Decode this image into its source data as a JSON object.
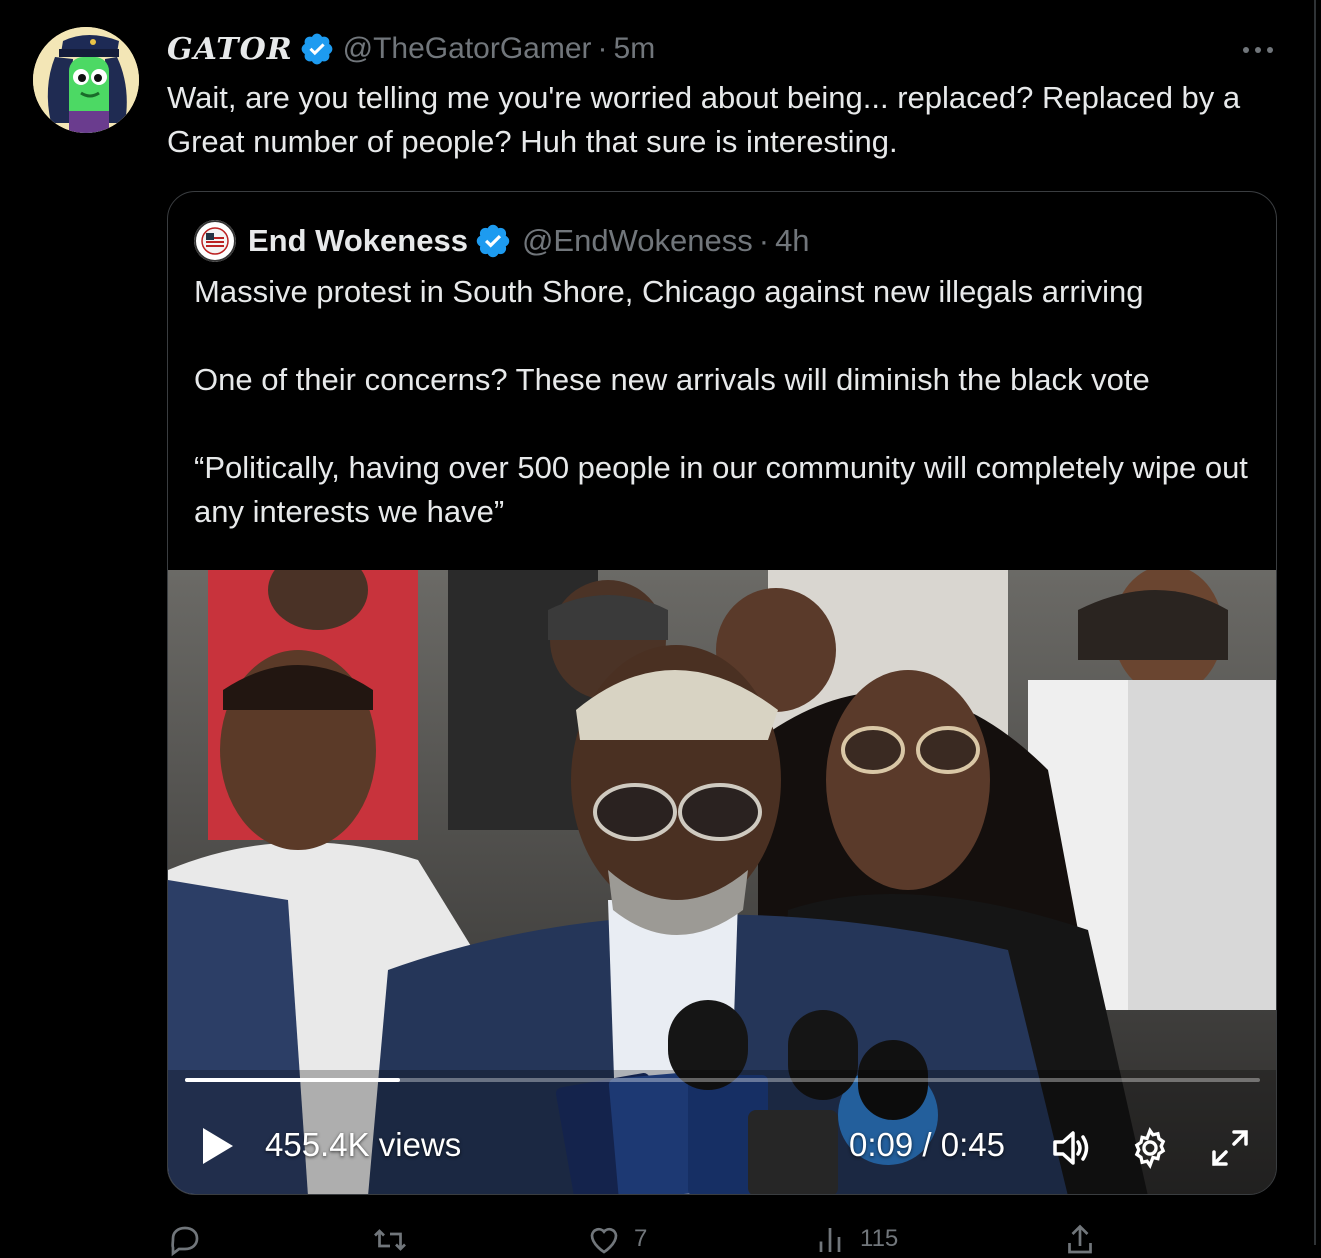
{
  "tweet": {
    "display_name": "GATOR",
    "handle": "@TheGatorGamer",
    "separator": "·",
    "time": "5m",
    "text": "Wait, are you telling me you're worried about being... replaced? Replaced by a Great number of people? Huh that sure is interesting."
  },
  "quote": {
    "display_name": "End Wokeness",
    "handle": "@EndWokeness",
    "separator": "·",
    "time": "4h",
    "text": "Massive protest in South Shore, Chicago against new illegals arriving\n\nOne of their concerns? These new arrivals will diminish the black vote\n\n“Politically, having over 500 people in our community will completely wipe out any interests we have”"
  },
  "video": {
    "views": "455.4K views",
    "time_display": "0:09 / 0:45",
    "progress": 0.2
  },
  "actions": {
    "likes": "7",
    "views": "115"
  },
  "colors": {
    "verified": "#1d9bf0",
    "muted": "#71767b",
    "text": "#e7e9ea"
  }
}
